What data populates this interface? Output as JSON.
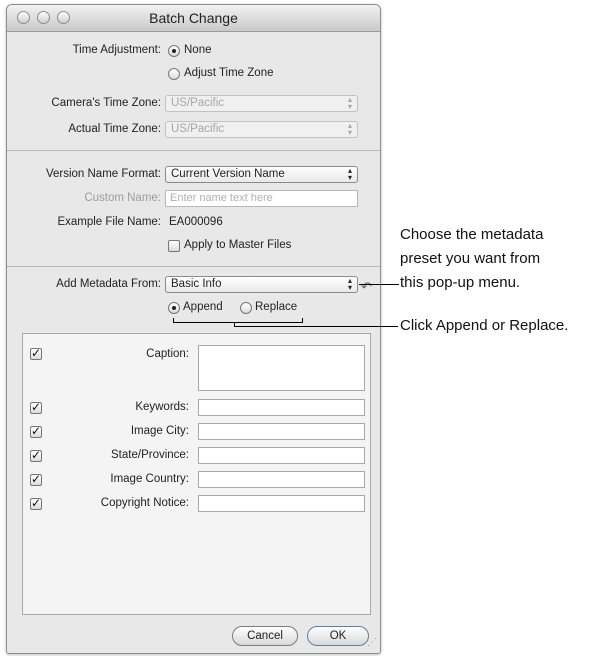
{
  "window": {
    "title": "Batch Change",
    "time_adjustment_label": "Time Adjustment:",
    "time_options": [
      "None",
      "Adjust Time Zone"
    ],
    "camera_tz_label": "Camera's Time Zone:",
    "camera_tz_value": "US/Pacific",
    "actual_tz_label": "Actual Time Zone:",
    "actual_tz_value": "US/Pacific",
    "version_format_label": "Version Name Format:",
    "version_format_value": "Current Version Name",
    "custom_name_label": "Custom Name:",
    "custom_name_placeholder": "Enter name text here",
    "example_file_label": "Example File Name:",
    "example_file_value": "EA000096",
    "apply_master_label": "Apply to Master Files",
    "add_metadata_label": "Add Metadata From:",
    "add_metadata_value": "Basic Info",
    "mode_options": [
      "Append",
      "Replace"
    ],
    "metadata_fields": [
      {
        "label": "Caption:",
        "checked": true
      },
      {
        "label": "Keywords:",
        "checked": true
      },
      {
        "label": "Image City:",
        "checked": true
      },
      {
        "label": "State/Province:",
        "checked": true
      },
      {
        "label": "Image Country:",
        "checked": true
      },
      {
        "label": "Copyright Notice:",
        "checked": true
      }
    ],
    "cancel_label": "Cancel",
    "ok_label": "OK"
  },
  "callouts": {
    "popup_note": [
      "Choose the metadata",
      "preset you want from",
      "this pop-up menu."
    ],
    "append_note": "Click Append or Replace."
  }
}
